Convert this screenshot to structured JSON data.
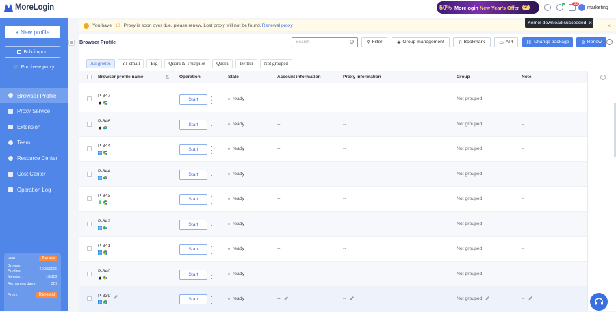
{
  "app": {
    "logo_text": "MoreLogin"
  },
  "promo": {
    "badge": "50%",
    "brand": "Morelogin",
    "offer": "New Year's Offer",
    "tag": "GO"
  },
  "header": {
    "notification_count": "33",
    "username": "marketing"
  },
  "toast": {
    "text": "Kernel download succeeded",
    "close": "×"
  },
  "sidebar": {
    "new_profile": "+ New profile",
    "bulk_import": "Bulk import",
    "purchase_proxy": "Purchase proxy",
    "items": [
      {
        "label": "Browser Profile",
        "active": true
      },
      {
        "label": "Proxy Service"
      },
      {
        "label": "Extension"
      },
      {
        "label": "Team"
      },
      {
        "label": "Resource Center"
      },
      {
        "label": "Cost Center"
      },
      {
        "label": "Operation Log"
      }
    ],
    "plan": {
      "plan_label": "Plan",
      "renew": "Renew",
      "profiles_label": "Browser Profiles:",
      "profiles_value": "250/10000",
      "member_label": "Member:",
      "member_value": "13/102",
      "days_label": "Remaining days:",
      "days_value": "307",
      "proxy_label": "Proxy:",
      "renewal": "Renewal"
    }
  },
  "notice": {
    "prefix": "You have",
    "count": "10",
    "suffix": "Proxy is soon over due, please renew. Lost proxy will not be found.",
    "link": "Renewal proxy",
    "close": "×"
  },
  "toolbar": {
    "title": "Browser Profile",
    "search_placeholder": "Search",
    "filter": "Filter",
    "group_management": "Group management",
    "bookmark": "Bookmark",
    "api": "API",
    "change_package": "Change package",
    "renew": "Renew"
  },
  "groups": [
    "All groups",
    "YT email",
    "Big",
    "Quora & Trustpilot",
    "Quora",
    "Twitter",
    "Not grouped"
  ],
  "table": {
    "columns": {
      "name": "Browser profile name",
      "operation": "Operation",
      "state": "State",
      "account": "Account information",
      "proxy": "Proxy information",
      "group": "Group",
      "note": "Note"
    },
    "start_label": "Start",
    "rows": [
      {
        "name": "P-347",
        "os": "apple",
        "state": "ready",
        "account": "--",
        "proxy": "--",
        "group": "Not grouped",
        "note": "--"
      },
      {
        "name": "P-346",
        "os": "apple",
        "state": "ready",
        "account": "--",
        "proxy": "--",
        "group": "Not grouped",
        "note": "--"
      },
      {
        "name": "P-344",
        "os": "windows",
        "state": "ready",
        "account": "--",
        "proxy": "--",
        "group": "Not grouped",
        "note": "--"
      },
      {
        "name": "P-344",
        "os": "windows",
        "state": "ready",
        "account": "--",
        "proxy": "--",
        "group": "Not grouped",
        "note": "--"
      },
      {
        "name": "P-343",
        "os": "android",
        "state": "ready",
        "account": "--",
        "proxy": "--",
        "group": "Not grouped",
        "note": "--"
      },
      {
        "name": "P-342",
        "os": "windows",
        "state": "ready",
        "account": "--",
        "proxy": "--",
        "group": "Not grouped",
        "note": "--"
      },
      {
        "name": "P-341",
        "os": "windows",
        "state": "ready",
        "account": "--",
        "proxy": "--",
        "group": "Not grouped",
        "note": "--"
      },
      {
        "name": "P-340",
        "os": "apple",
        "state": "ready",
        "account": "--",
        "proxy": "--",
        "group": "Not grouped",
        "note": "--"
      },
      {
        "name": "P-339",
        "os": "windows",
        "state": "ready",
        "account": "--",
        "proxy": "--",
        "group": "Not grouped",
        "note": "--"
      }
    ]
  }
}
